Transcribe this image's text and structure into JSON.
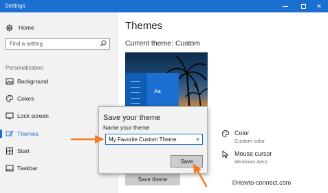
{
  "window": {
    "title": "Settings",
    "controls": {
      "minimize": "minimize-icon",
      "maximize": "maximize-icon",
      "close": "✕"
    }
  },
  "sidebar": {
    "home": {
      "label": "Home",
      "icon": "gear-icon"
    },
    "search": {
      "placeholder": "Find a setting",
      "icon": "search-icon"
    },
    "section": "Personalization",
    "items": [
      {
        "label": "Background",
        "icon": "picture-icon",
        "active": false
      },
      {
        "label": "Colors",
        "icon": "palette-icon",
        "active": false
      },
      {
        "label": "Lock screen",
        "icon": "monitor-icon",
        "active": false
      },
      {
        "label": "Themes",
        "icon": "brush-icon",
        "active": true
      },
      {
        "label": "Start",
        "icon": "grid-icon",
        "active": false
      },
      {
        "label": "Taskbar",
        "icon": "taskbar-icon",
        "active": false
      }
    ]
  },
  "main": {
    "title": "Themes",
    "current_theme": "Current theme: Custom",
    "preview_aa": "Aa",
    "properties": [
      {
        "title": "Color",
        "subtitle": "Custom color",
        "icon": "palette-icon"
      },
      {
        "title": "Mouse cursor",
        "subtitle": "Windows Aero",
        "icon": "cursor-icon"
      }
    ],
    "save_theme_button": "Save theme"
  },
  "dialog": {
    "title": "Save your theme",
    "label": "Name your theme",
    "input_value": "My Favorite Custom Theme",
    "clear_glyph": "×",
    "save_button": "Save"
  },
  "watermark": "©Howto-connect.com",
  "colors": {
    "accent": "#1a6fd0",
    "arrow": "#f07d22",
    "sidebar_bg": "#f2f2f2"
  }
}
